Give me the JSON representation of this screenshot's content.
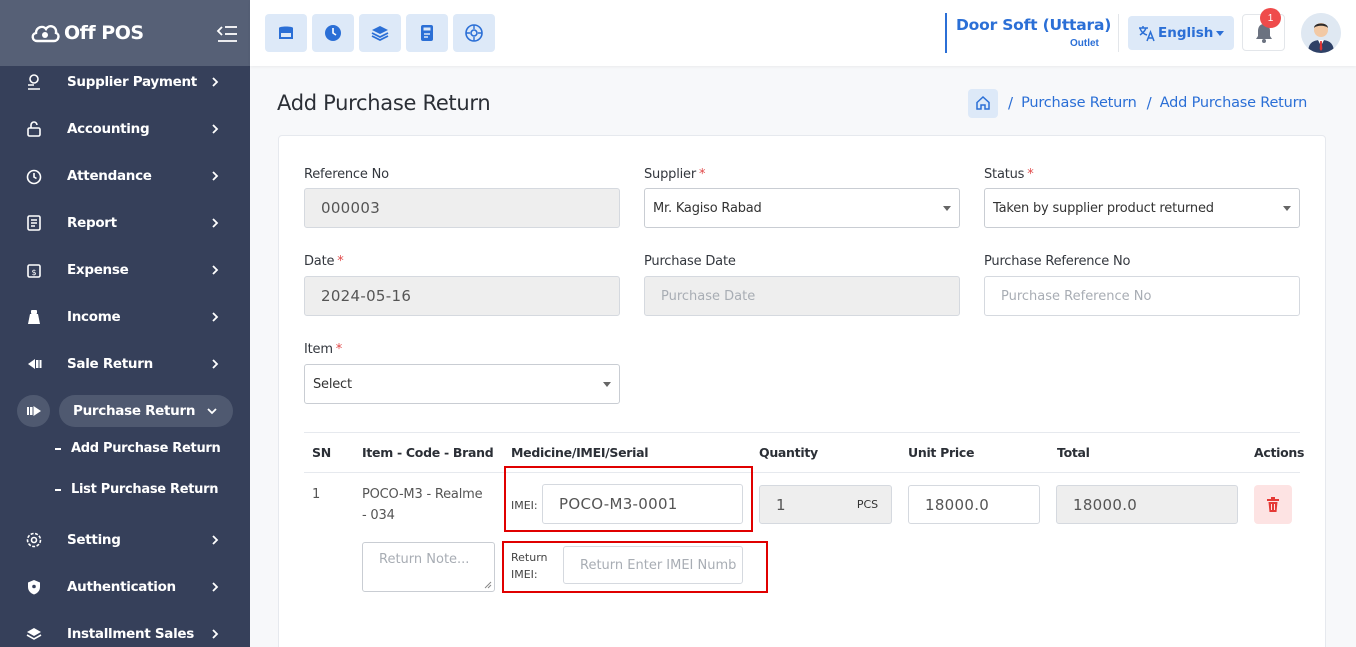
{
  "brand": {
    "name": "Off POS"
  },
  "sidebar": {
    "items": [
      {
        "label": "Supplier Payment",
        "icon": "supplier-payment-icon"
      },
      {
        "label": "Accounting",
        "icon": "lock-icon"
      },
      {
        "label": "Attendance",
        "icon": "alarm-clock-icon"
      },
      {
        "label": "Report",
        "icon": "report-icon"
      },
      {
        "label": "Expense",
        "icon": "expense-icon"
      },
      {
        "label": "Income",
        "icon": "income-bag-icon"
      },
      {
        "label": "Sale Return",
        "icon": "sale-return-icon"
      },
      {
        "label": "Purchase Return",
        "icon": "purchase-return-icon",
        "active": true
      },
      {
        "label": "Setting",
        "icon": "gear-icon"
      },
      {
        "label": "Authentication",
        "icon": "shield-icon"
      },
      {
        "label": "Installment Sales",
        "icon": "layers-icon"
      }
    ],
    "sub_items": [
      {
        "label": "Add Purchase Return"
      },
      {
        "label": "List Purchase Return"
      }
    ]
  },
  "header": {
    "quick_buttons": [
      "pos-icon",
      "clock-icon",
      "layers-icon",
      "calculator-icon",
      "dashboard-icon"
    ],
    "outlet_name": "Door Soft (Uttara)",
    "outlet_label": "Outlet",
    "language": "English",
    "notification_count": "1"
  },
  "page": {
    "title": "Add Purchase Return",
    "breadcrumb": [
      "Purchase Return",
      "Add Purchase Return"
    ]
  },
  "form": {
    "reference_no": {
      "label": "Reference No",
      "value": "000003"
    },
    "supplier": {
      "label": "Supplier",
      "value": "Mr. Kagiso Rabad"
    },
    "status": {
      "label": "Status",
      "value": "Taken by supplier product returned"
    },
    "date": {
      "label": "Date",
      "value": "2024-05-16"
    },
    "purchase_date": {
      "label": "Purchase Date",
      "placeholder": "Purchase Date"
    },
    "purchase_reference_no": {
      "label": "Purchase Reference No",
      "placeholder": "Purchase Reference No"
    },
    "item": {
      "label": "Item",
      "value": "Select"
    },
    "required_mark": "*"
  },
  "table": {
    "headers": [
      "SN",
      "Item - Code - Brand",
      "Medicine/IMEI/Serial",
      "Quantity",
      "Unit Price",
      "Total",
      "Actions"
    ],
    "rows": [
      {
        "sn": "1",
        "item_line1": "POCO-M3 - Realme",
        "item_line2": "- 034",
        "imei_label": "IMEI:",
        "imei_value": "POCO-M3-0001",
        "return_imei_label_1": "Return",
        "return_imei_label_2": "IMEI:",
        "return_imei_placeholder": "Return Enter IMEI Numb",
        "quantity": "1",
        "unit": "PCS",
        "unit_price": "18000.0",
        "total": "18000.0",
        "note_placeholder": "Return Note..."
      }
    ]
  },
  "colors": {
    "sidebar_bg": "#36405a",
    "brand_bg": "#566076",
    "accent": "#2b6fd6",
    "highlight": "#e00000",
    "danger": "#ef4b4b"
  }
}
